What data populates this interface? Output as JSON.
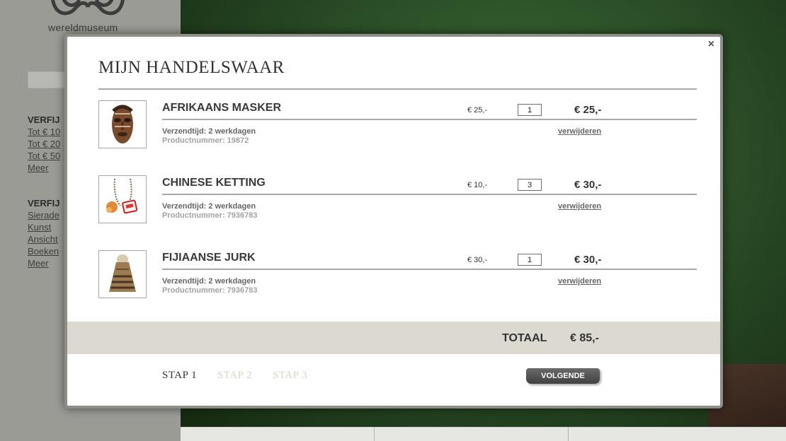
{
  "background": {
    "logo_text": "wereldmuseum",
    "sidebar_sections": [
      {
        "heading": "VERFIJ",
        "links": [
          "Tot € 10",
          "Tot € 20",
          "Tot € 50",
          "Meer"
        ]
      },
      {
        "heading": "VERFIJ",
        "links": [
          "Sierade",
          "Kunst",
          "Ansicht",
          "Boeken",
          "Meer"
        ]
      }
    ]
  },
  "modal": {
    "title": "MIJN HANDELSWAAR",
    "close_label": "×",
    "items": [
      {
        "name": "AFRIKAANS MASKER",
        "unit_price": "€ 25,-",
        "quantity": "1",
        "line_total": "€ 25,-",
        "shipping": "Verzendtijd: 2 werkdagen",
        "product_number": "Productnummer: 19872",
        "remove_label": "verwijderen"
      },
      {
        "name": "CHINESE KETTING",
        "unit_price": "€ 10,-",
        "quantity": "3",
        "line_total": "€ 30,-",
        "shipping": "Verzendtijd: 2 werkdagen",
        "product_number": "Productnummer: 7936783",
        "remove_label": "verwijderen"
      },
      {
        "name": "FIJIAANSE JURK",
        "unit_price": "€ 30,-",
        "quantity": "1",
        "line_total": "€ 30,-",
        "shipping": "Verzendtijd: 2 werkdagen",
        "product_number": "Productnummer: 7936783",
        "remove_label": "verwijderen"
      }
    ],
    "total_label": "TOTAAL",
    "total_value": "€ 85,-",
    "steps": [
      "STAP 1",
      "STAP 2",
      "STAP 3"
    ],
    "next_label": "VOLGENDE"
  },
  "colors": {
    "total_bar": "#dcdad0",
    "inactive_step": "#d9d4c2",
    "sidebar": "#9b9b96",
    "scene": "#2d5229"
  }
}
